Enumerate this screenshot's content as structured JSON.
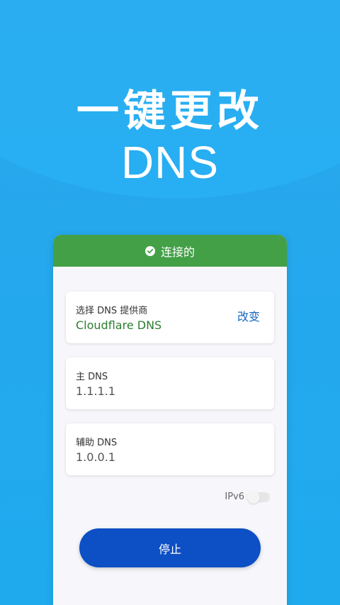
{
  "hero": {
    "title": "一键更改",
    "subtitle": "DNS"
  },
  "status": {
    "text": "连接的",
    "icon": "check-circle-icon",
    "color": "#43a047"
  },
  "provider": {
    "label": "选择 DNS 提供商",
    "value": "Cloudflare DNS",
    "change_label": "改变"
  },
  "primary_dns": {
    "label": "主 DNS",
    "value": "1.1.1.1"
  },
  "secondary_dns": {
    "label": "辅助 DNS",
    "value": "1.0.0.1"
  },
  "ipv6": {
    "label": "IPv6",
    "enabled": false
  },
  "stop_button": {
    "label": "停止",
    "color": "#0d4fc4"
  },
  "colors": {
    "background": "#1faaee",
    "accent_blue": "#1565c0",
    "provider_green": "#2e7d32"
  }
}
